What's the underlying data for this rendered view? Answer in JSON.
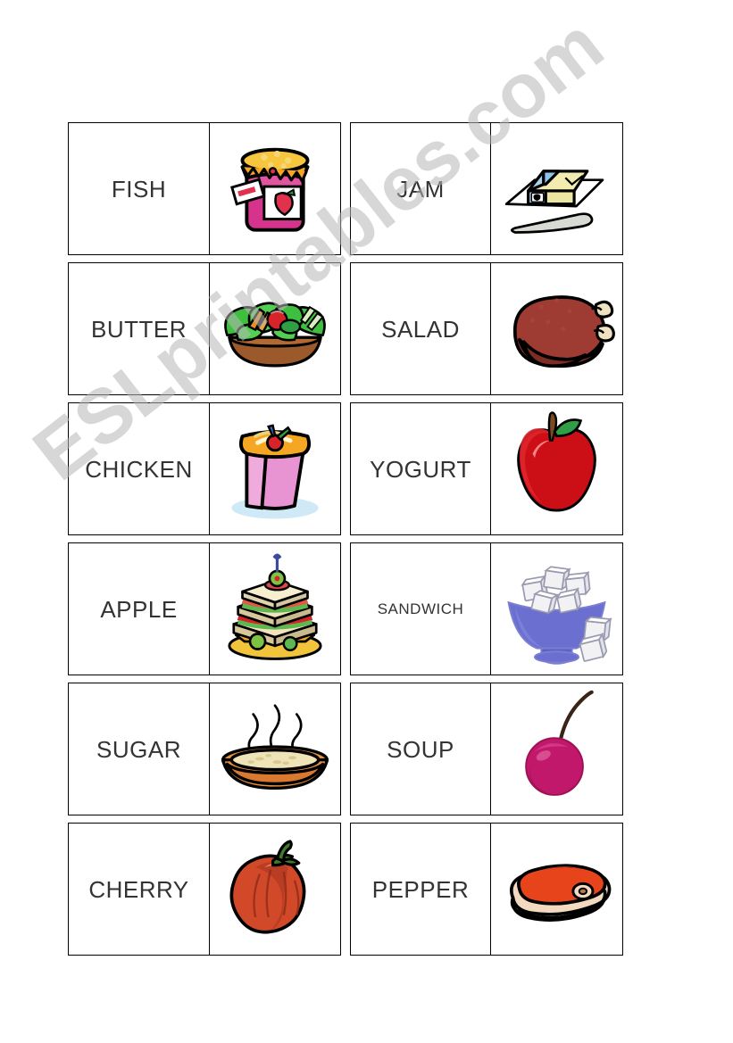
{
  "page": {
    "watermark": "ESLprintables.com",
    "background_color": "#ffffff",
    "border_color": "#000000",
    "text_color": "#333333"
  },
  "dominoes": [
    {
      "word": "FISH",
      "picture": "jam-jar-icon",
      "word_size": "normal"
    },
    {
      "word": "JAM",
      "picture": "butter-icon",
      "word_size": "normal"
    },
    {
      "word": "BUTTER",
      "picture": "salad-bowl-icon",
      "word_size": "normal"
    },
    {
      "word": "SALAD",
      "picture": "chicken-icon",
      "word_size": "normal"
    },
    {
      "word": "CHICKEN",
      "picture": "yogurt-cup-icon",
      "word_size": "normal"
    },
    {
      "word": "YOGURT",
      "picture": "apple-icon",
      "word_size": "normal"
    },
    {
      "word": "APPLE",
      "picture": "sandwich-icon",
      "word_size": "normal"
    },
    {
      "word": "SANDWICH",
      "picture": "sugar-bowl-icon",
      "word_size": "small"
    },
    {
      "word": "SUGAR",
      "picture": "soup-bowl-icon",
      "word_size": "normal"
    },
    {
      "word": "SOUP",
      "picture": "cherry-icon",
      "word_size": "normal"
    },
    {
      "word": "CHERRY",
      "picture": "pepper-icon",
      "word_size": "normal"
    },
    {
      "word": "PEPPER",
      "picture": "steak-icon",
      "word_size": "normal"
    }
  ],
  "colors": {
    "jam_body": "#d6348c",
    "jam_lid": "#f5a623",
    "butter_block": "#f2ecb0",
    "butter_wrap": "#a8d3ef",
    "salad_green": "#44c countdown",
    "chicken_body": "#9e3b33",
    "yogurt_cup": "#e894d2",
    "apple_red": "#cc0f16",
    "sandwich_plate": "#f2c43c",
    "sugar_bowl": "#6a6fd0",
    "soup_bowl": "#e8913c",
    "cherry": "#c2186c",
    "pepper_red": "#d2492a",
    "steak_red": "#e8441c"
  }
}
